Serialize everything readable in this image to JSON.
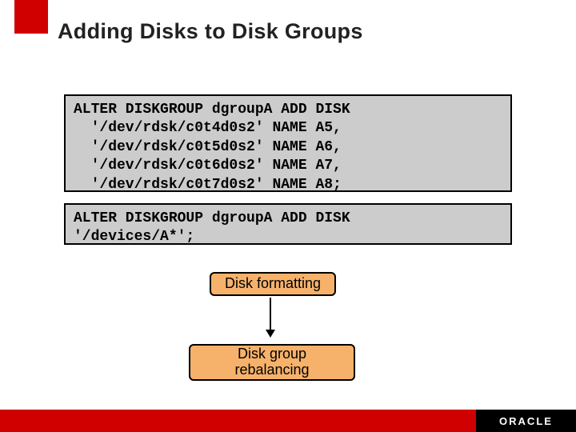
{
  "title": "Adding Disks to Disk Groups",
  "code1": "ALTER DISKGROUP dgroupA ADD DISK\n  '/dev/rdsk/c0t4d0s2' NAME A5,\n  '/dev/rdsk/c0t5d0s2' NAME A6,\n  '/dev/rdsk/c0t6d0s2' NAME A7,\n  '/dev/rdsk/c0t7d0s2' NAME A8;",
  "code2": "ALTER DISKGROUP dgroupA ADD DISK\n'/devices/A*';",
  "flow": {
    "step1": "Disk formatting",
    "step2": "Disk group\nrebalancing"
  },
  "footer": {
    "brand": "ORACLE"
  }
}
